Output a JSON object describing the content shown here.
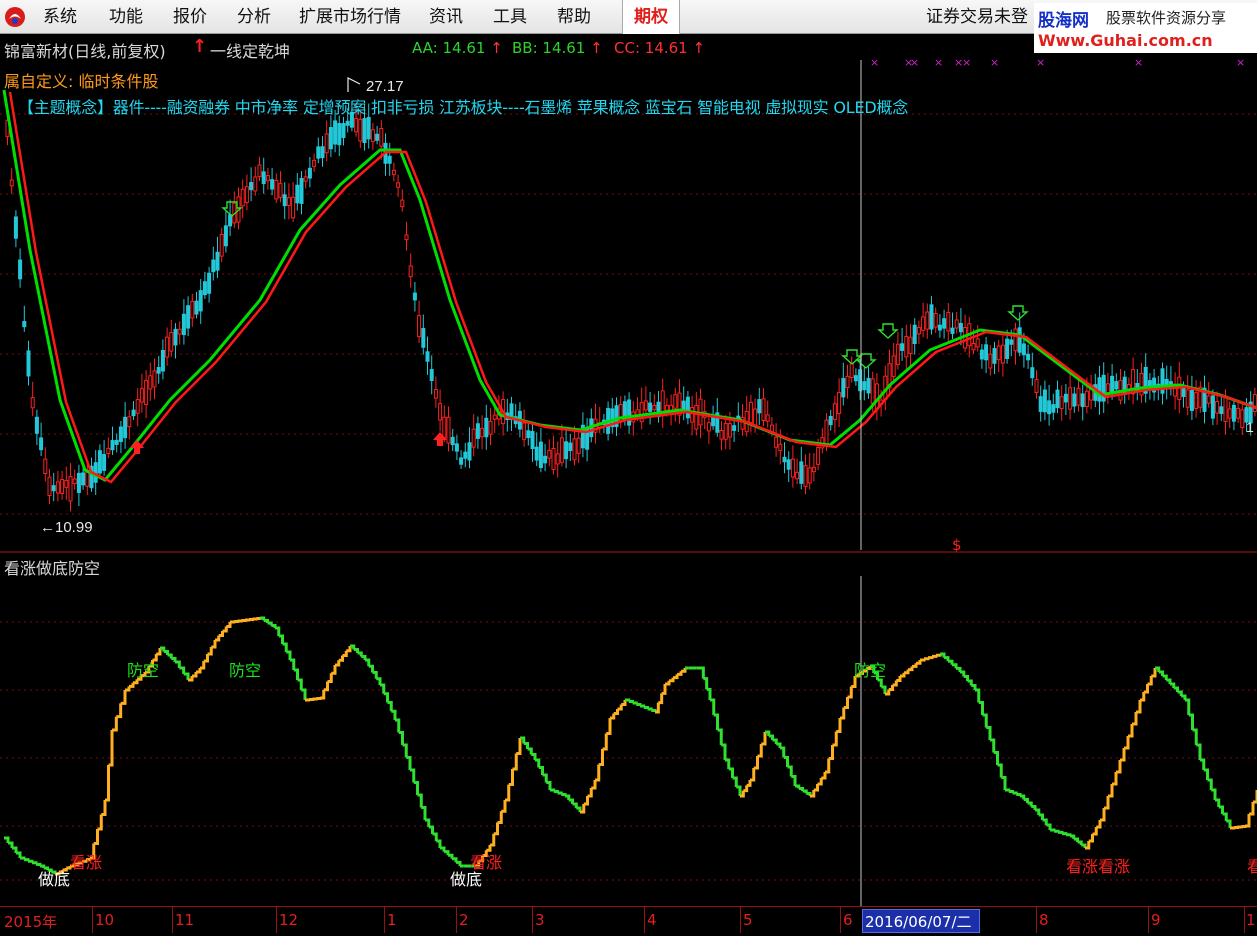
{
  "menu": {
    "items": [
      "系统",
      "功能",
      "报价",
      "分析",
      "扩展市场行情",
      "资讯",
      "工具",
      "帮助"
    ],
    "options_tab": "期权",
    "login_status": "证券交易未登"
  },
  "watermark": {
    "brand": "股海网",
    "tagline": "股票软件资源分享",
    "url": "Www.Guhai.com.cn"
  },
  "main_chart": {
    "title": "锦富新材(日线,前复权)",
    "strategy_arrow": "↑",
    "strategy": "一线定乾坤",
    "aa": "AA: 14.61",
    "bb": "BB: 14.61",
    "cc": "CC: 14.61",
    "custom_label": "属自定义: 临时条件股",
    "concepts": "【主题概念】器件----融资融券 中市净率 定增预案 扣非亏损 江苏板块----石墨烯 苹果概念 蓝宝石 智能电视 虚拟现实 OLED概念",
    "high_label": "27.17",
    "low_label": "←10.99",
    "right_edge_label": "1",
    "signal_marker": "$",
    "colors": {
      "up": "#ff2020",
      "down": "#22c8d8",
      "ma_red": "#ff1818",
      "ma_green": "#00e000",
      "grid": "#7a0c0c"
    }
  },
  "indicator": {
    "title": "看涨做底防空",
    "labels": [
      {
        "text": "防空",
        "color": "#1ee01e"
      },
      {
        "text": "防空",
        "color": "#1ee01e"
      },
      {
        "text": "防空",
        "color": "#1ee01e"
      },
      {
        "text": "看涨",
        "color": "#ff2020"
      },
      {
        "text": "做底",
        "color": "#ffffff"
      },
      {
        "text": "看涨",
        "color": "#ff2020"
      },
      {
        "text": "做底",
        "color": "#ffffff"
      },
      {
        "text": "看涨看涨",
        "color": "#ff2020"
      },
      {
        "text": "看",
        "color": "#ff2020"
      }
    ],
    "colors": {
      "rising": "#ffb020",
      "falling": "#30e030"
    }
  },
  "date_axis": {
    "labels": [
      "2015年",
      "10",
      "11",
      "12",
      "1",
      "2",
      "3",
      "4",
      "5",
      "6",
      "8",
      "9",
      "1"
    ],
    "cursor_date": "2016/06/07/二"
  }
}
